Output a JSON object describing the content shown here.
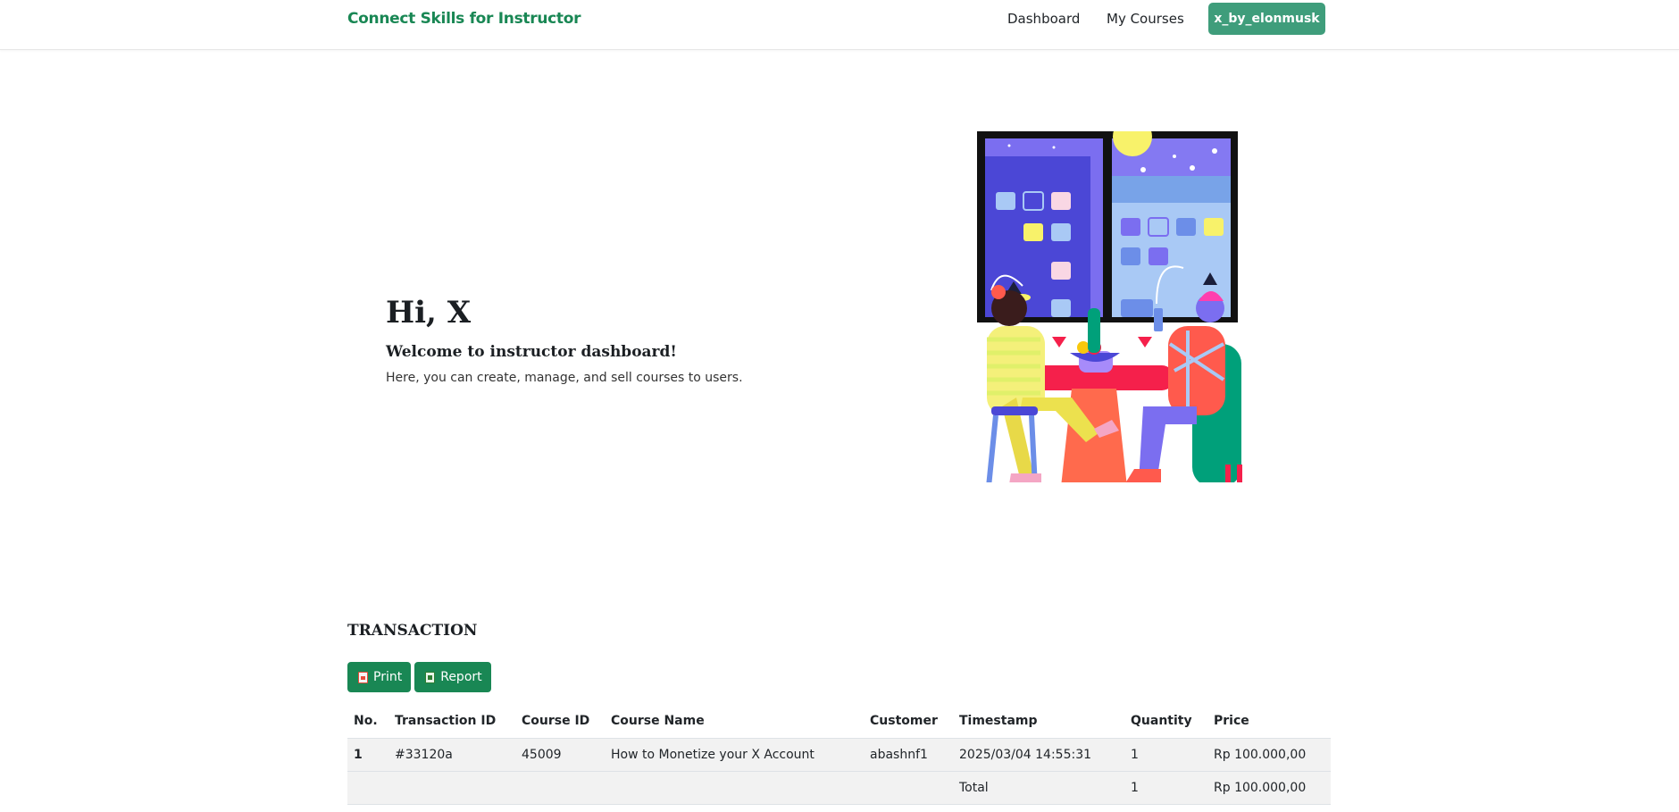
{
  "navbar": {
    "brand": "Connect Skills for Instructor",
    "links": [
      "Dashboard",
      "My Courses"
    ],
    "user_button": "x_by_elonmusk"
  },
  "hero": {
    "greeting": "Hi, X",
    "subtitle": "Welcome to instructor dashboard!",
    "description": "Here, you can create, manage, and sell courses to users."
  },
  "transaction": {
    "title": "TRANSACTION",
    "buttons": {
      "print": "Print",
      "report": "Report"
    },
    "columns": [
      "No.",
      "Transaction ID",
      "Course ID",
      "Course Name",
      "Customer",
      "Timestamp",
      "Quantity",
      "Price"
    ],
    "rows": [
      [
        "1",
        "#33120a",
        "45009",
        "How to Monetize your X Account",
        "abashnf1",
        "2025/03/04 14:55:31",
        "1",
        "Rp 100.000,00"
      ]
    ],
    "total": {
      "label": "Total",
      "quantity": "1",
      "price": "Rp 100.000,00"
    }
  },
  "colors": {
    "brand": "#198754",
    "user_button": "#3f9d7b"
  },
  "icons": [
    "pdf-icon",
    "excel-icon"
  ]
}
